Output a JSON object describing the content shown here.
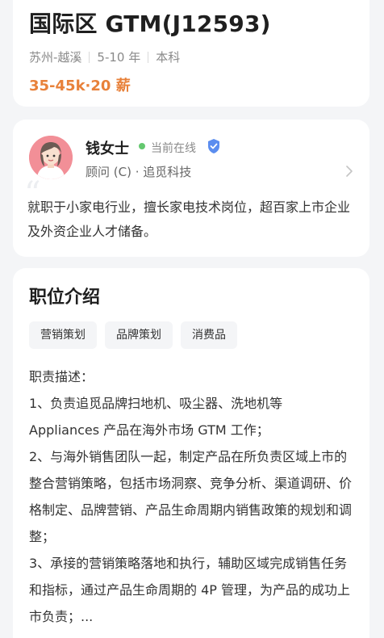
{
  "job": {
    "title": "国际区 GTM(J12593)",
    "location": "苏州-越溪",
    "experience": "5-10 年",
    "education": "本科",
    "salary": "35-45k·20 薪"
  },
  "recruiter": {
    "name": "钱女士",
    "status": "当前在线",
    "role": "顾问 (C) · 追觅科技",
    "intro": "就职于小家电行业，擅长家电技术岗位，超百家上市企业及外资企业人才储备。"
  },
  "description": {
    "title": "职位介绍",
    "tags": [
      "营销策划",
      "品牌策划",
      "消费品"
    ],
    "lines": [
      "职责描述：",
      "1、负责追觅品牌扫地机、吸尘器、洗地机等 Appliances 产品在海外市场 GTM 工作；",
      "2、与海外销售团队一起，制定产品在所负责区域上市的整合营销策略，包括市场洞察、竞争分析、渠道调研、价格制定、品牌营销、产品生命周期内销售政策的规划和调整；",
      "3、承接的营销策略落地和执行，辅助区域完成销售任务和指标，通过产品生命周期的 4P 管理，为产品的成功上市负责；..."
    ]
  },
  "colors": {
    "salary": "#e8813a",
    "online": "#64c86f",
    "verified": "#5b8def",
    "avatar_bg": "#f28f97"
  },
  "icons": {
    "verified": "verified-shield-icon",
    "chevron": "chevron-right-icon",
    "quote": "quote-icon"
  }
}
